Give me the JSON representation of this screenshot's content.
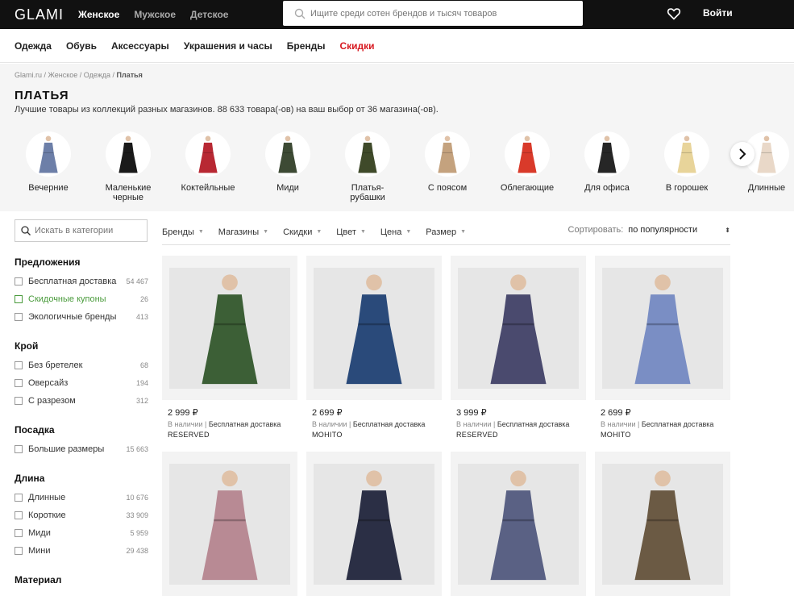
{
  "header": {
    "logo": "GLAMI",
    "gender_tabs": [
      "Женское",
      "Мужское",
      "Детское"
    ],
    "search_placeholder": "Ищите среди сотен брендов и тысяч товаров",
    "login": "Войти"
  },
  "categories": [
    "Одежда",
    "Обувь",
    "Аксессуары",
    "Украшения и часы",
    "Бренды",
    "Скидки"
  ],
  "breadcrumb": [
    "Glami.ru",
    "Женское",
    "Одежда",
    "Платья"
  ],
  "page": {
    "title": "ПЛАТЬЯ",
    "subtitle": "Лучшие товары из коллекций разных магазинов. 88 633 товара(-ов) на ваш выбор от 36 магазина(-ов)."
  },
  "dress_types": [
    {
      "label": "Вечерние",
      "color": "#6d7fa8"
    },
    {
      "label": "Маленькие черные",
      "color": "#1a1a1a"
    },
    {
      "label": "Коктейльные",
      "color": "#b82833"
    },
    {
      "label": "Миди",
      "color": "#3d4a34"
    },
    {
      "label": "Платья-рубашки",
      "color": "#3f4a2a"
    },
    {
      "label": "С поясом",
      "color": "#c4a27e"
    },
    {
      "label": "Облегающие",
      "color": "#d93a2a"
    },
    {
      "label": "Для офиса",
      "color": "#262626"
    },
    {
      "label": "В горошек",
      "color": "#e8d49a"
    },
    {
      "label": "Длинные",
      "color": "#e9d8c8"
    }
  ],
  "sidebar": {
    "search_placeholder": "Искать в категории",
    "sections": [
      {
        "title": "Предложения",
        "options": [
          {
            "label": "Бесплатная доставка",
            "count": "54 467"
          },
          {
            "label": "Скидочные купоны",
            "count": "26",
            "highlight": true
          },
          {
            "label": "Экологичные бренды",
            "count": "413"
          }
        ]
      },
      {
        "title": "Крой",
        "options": [
          {
            "label": "Без бретелек",
            "count": "68"
          },
          {
            "label": "Оверсайз",
            "count": "194"
          },
          {
            "label": "С разрезом",
            "count": "312"
          }
        ]
      },
      {
        "title": "Посадка",
        "options": [
          {
            "label": "Большие размеры",
            "count": "15 663"
          }
        ]
      },
      {
        "title": "Длина",
        "options": [
          {
            "label": "Длинные",
            "count": "10 676"
          },
          {
            "label": "Короткие",
            "count": "33 909"
          },
          {
            "label": "Миди",
            "count": "5 959"
          },
          {
            "label": "Мини",
            "count": "29 438"
          }
        ]
      },
      {
        "title": "Материал",
        "options": []
      }
    ]
  },
  "filters": [
    "Бренды",
    "Магазины",
    "Скидки",
    "Цвет",
    "Цена",
    "Размер"
  ],
  "sort": {
    "label": "Сортировать:",
    "value": "по популярности"
  },
  "products": [
    {
      "price": "2 999 ₽",
      "status": "В наличии",
      "delivery": "Бесплатная доставка",
      "brand": "RESERVED",
      "color": "#3c5f36"
    },
    {
      "price": "2 699 ₽",
      "status": "В наличии",
      "delivery": "Бесплатная доставка",
      "brand": "MOHITO",
      "color": "#2a4a7a"
    },
    {
      "price": "3 999 ₽",
      "status": "В наличии",
      "delivery": "Бесплатная доставка",
      "brand": "RESERVED",
      "color": "#4a4a6e"
    },
    {
      "price": "2 699 ₽",
      "status": "В наличии",
      "delivery": "Бесплатная доставка",
      "brand": "MOHITO",
      "color": "#7a8ec4"
    },
    {
      "color": "#b88a94"
    },
    {
      "color": "#2b2f45"
    },
    {
      "color": "#5a6184"
    },
    {
      "color": "#6b5a44"
    }
  ]
}
